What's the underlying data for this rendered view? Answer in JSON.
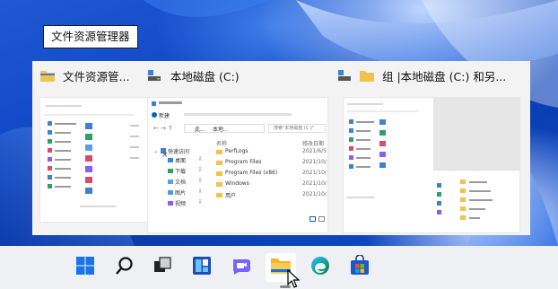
{
  "tooltip": {
    "text": "文件资源管理器"
  },
  "thumbnails": [
    {
      "title": "文件资源管...",
      "icon": "file-explorer-icon",
      "has_close": true,
      "close_label": "×"
    },
    {
      "title": "本地磁盘 (C:)",
      "icon": "drive-icon"
    },
    {
      "title": "组 |本地磁盘 (C:) 和另...",
      "icon": "group-folder-icon"
    }
  ],
  "explorer_preview": {
    "new_label": "新建",
    "nav_pinned": "快速访问",
    "path": [
      "此...",
      "本地..."
    ],
    "search_placeholder": "搜索\"本地磁盘 (C:)\"",
    "columns": [
      "名称",
      "修改日期"
    ],
    "sidebar_items": [
      "桌面",
      "下载",
      "文档",
      "图片",
      "视频"
    ],
    "rows": [
      {
        "name": "PerfLogs",
        "date": "2021/6/5"
      },
      {
        "name": "Program Files",
        "date": "2021/10/"
      },
      {
        "name": "Program Files (x86)",
        "date": "2021/10/"
      },
      {
        "name": "Windows",
        "date": "2021/10/"
      },
      {
        "name": "用户",
        "date": "2021/10/"
      }
    ]
  },
  "taskbar": {
    "items": [
      {
        "name": "start-button",
        "icon": "windows-logo-icon"
      },
      {
        "name": "search-button",
        "icon": "search-icon"
      },
      {
        "name": "task-view-button",
        "icon": "task-view-icon"
      },
      {
        "name": "widgets-button",
        "icon": "widgets-icon"
      },
      {
        "name": "chat-button",
        "icon": "teams-chat-icon"
      },
      {
        "name": "file-explorer-button",
        "icon": "folder-icon",
        "active": true
      },
      {
        "name": "edge-button",
        "icon": "edge-icon"
      },
      {
        "name": "store-button",
        "icon": "store-icon"
      }
    ]
  },
  "colors": {
    "accent": "#0067c0",
    "folder": "#f2c14e",
    "taskbar": "#eef0f4",
    "wallpaper": "#1550d2"
  }
}
